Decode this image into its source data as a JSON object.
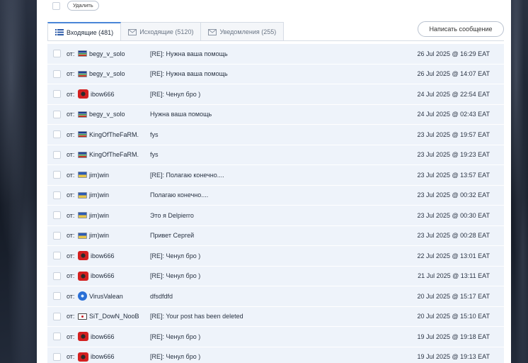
{
  "toolbar": {
    "delete_label": "Удалить"
  },
  "tabs": [
    {
      "label": "Входящие (481)",
      "icon": "list-icon",
      "active": true
    },
    {
      "label": "Исходящие (5120)",
      "icon": "envelope-icon",
      "active": false
    },
    {
      "label": "Уведомления (255)",
      "icon": "envelope-icon",
      "active": false
    }
  ],
  "compose_label": "Написать сообщение",
  "from_prefix": "от:",
  "messages": [
    {
      "sender": "begy_v_solo",
      "flag": "striped",
      "subject": "[RE]: Нужна ваша помощь",
      "date": "26 Jul 2025 @ 16:29 EAT"
    },
    {
      "sender": "begy_v_solo",
      "flag": "striped",
      "subject": "[RE]: Нужна ваша помощь",
      "date": "26 Jul 2025 @ 14:07 EAT"
    },
    {
      "sender": "ibow666",
      "flag": "red",
      "subject": "[RE]: Ченул бро )",
      "date": "24 Jul 2025 @ 22:54 EAT"
    },
    {
      "sender": "begy_v_solo",
      "flag": "striped",
      "subject": "Нужна ваша помощь",
      "date": "24 Jul 2025 @ 02:43 EAT"
    },
    {
      "sender": "KingOfTheFaRM.",
      "flag": "striped",
      "subject": "fys",
      "date": "23 Jul 2025 @ 19:57 EAT"
    },
    {
      "sender": "KingOfTheFaRM.",
      "flag": "striped",
      "subject": "fys",
      "date": "23 Jul 2025 @ 19:23 EAT"
    },
    {
      "sender": "jim)win",
      "flag": "striped2",
      "subject": "[RE]: Полагаю конечно....",
      "date": "23 Jul 2025 @ 13:57 EAT"
    },
    {
      "sender": "jim)win",
      "flag": "striped2",
      "subject": "Полагаю конечно....",
      "date": "23 Jul 2025 @ 00:32 EAT"
    },
    {
      "sender": "jim)win",
      "flag": "striped2",
      "subject": "Это я Delpierro",
      "date": "23 Jul 2025 @ 00:30 EAT"
    },
    {
      "sender": "jim)win",
      "flag": "striped2",
      "subject": "Привет Сергей",
      "date": "23 Jul 2025 @ 00:28 EAT"
    },
    {
      "sender": "ibow666",
      "flag": "red",
      "subject": "[RE]: Ченул бро )",
      "date": "22 Jul 2025 @ 13:01 EAT"
    },
    {
      "sender": "ibow666",
      "flag": "red",
      "subject": "[RE]: Ченул бро )",
      "date": "21 Jul 2025 @ 13:11 EAT"
    },
    {
      "sender": "VirusValean",
      "flag": "blue",
      "subject": "dfsdfdfd",
      "date": "20 Jul 2025 @ 15:17 EAT"
    },
    {
      "sender": "SiT_DowN_NooB",
      "flag": "korea",
      "subject": "[RE]: Your post has been deleted",
      "date": "20 Jul 2025 @ 15:10 EAT"
    },
    {
      "sender": "ibow666",
      "flag": "red",
      "subject": "[RE]: Ченул бро )",
      "date": "19 Jul 2025 @ 19:18 EAT"
    },
    {
      "sender": "ibow666",
      "flag": "red",
      "subject": "[RE]: Ченул бро )",
      "date": "19 Jul 2025 @ 19:13 EAT"
    }
  ]
}
